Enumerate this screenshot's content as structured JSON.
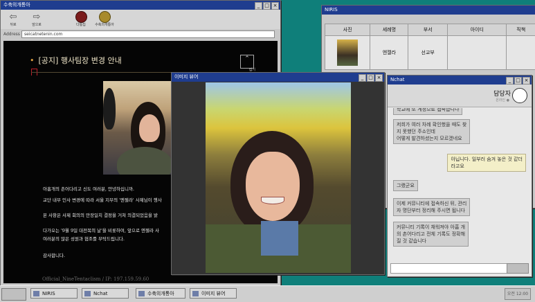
{
  "browser": {
    "title": "수축의개통아",
    "tools": [
      {
        "icon": "back-arrow-icon",
        "label": "뒤로"
      },
      {
        "icon": "forward-arrow-icon",
        "label": "앞으로"
      },
      {
        "icon": "emblem-icon",
        "label": "다통집"
      },
      {
        "icon": "seal-icon",
        "label": "수축의개통아"
      }
    ],
    "address_label": "Address",
    "url": "seicatnetenin.com",
    "notice_title": "[공지] 행사팀장 변경 안내",
    "close_label": "접기",
    "paragraphs": [
      "아홉개의 촌어다리고 신도 여러분, 안녕하십니까.",
      "교단 내부 인사 변경에 따라 서울 지부의 '엔젤라' 사제님이 행사",
      "본 사항은 사제 회의의 만장일치 결정을 거쳐 의결되었음을 밝",
      "다가오는 '9월 9일 대전복의 날'을 비롯하여, 앞으로 엔젤라 사",
      "여러분의 많은 성원과 협조를 부탁드립니다.",
      "감사합니다."
    ],
    "footer": "Official_NineTentaclism / IP: 197.159.59.60"
  },
  "niris": {
    "title": "NIRIS",
    "headers": [
      "사진",
      "세례명",
      "부서",
      "아이디",
      "직책"
    ],
    "row": {
      "name": "엔젤라",
      "dept": "선교부",
      "id": "",
      "role": ""
    }
  },
  "viewer": {
    "title": "이미지 뷰어"
  },
  "nchat": {
    "title": "Nchat",
    "contact": "담당자",
    "status": "온라인 ●",
    "messages": [
      {
        "from": "them",
        "text": "학교에 또 계정으로 접속합니다"
      },
      {
        "from": "them",
        "text": "저희가 여러 차례 확인했을 때도 찾\n지 못했던 주소인데\n어떻게 발견하셨는지 모르겠네요"
      },
      {
        "from": "me",
        "text": "아닙니다. 일부러 숨겨 놓은 것 같더\n라고요"
      },
      {
        "from": "them",
        "text": "그랬군요"
      },
      {
        "from": "them",
        "text": "이제 커뮤니티에 접속하신 뒤, 관리\n자 명단부터 정리해 주시면 됩니다"
      },
      {
        "from": "them",
        "text": "커뮤니티 기록이 채워져야 아홉 개\n의 촌어다리고 전체 기록도 정확해\n질 것 같습니다"
      }
    ]
  },
  "taskbar": {
    "items": [
      "NIRIS",
      "Nchat",
      "수축의개통아",
      "이미지 뷰어"
    ],
    "clock": "오전 12:00"
  }
}
